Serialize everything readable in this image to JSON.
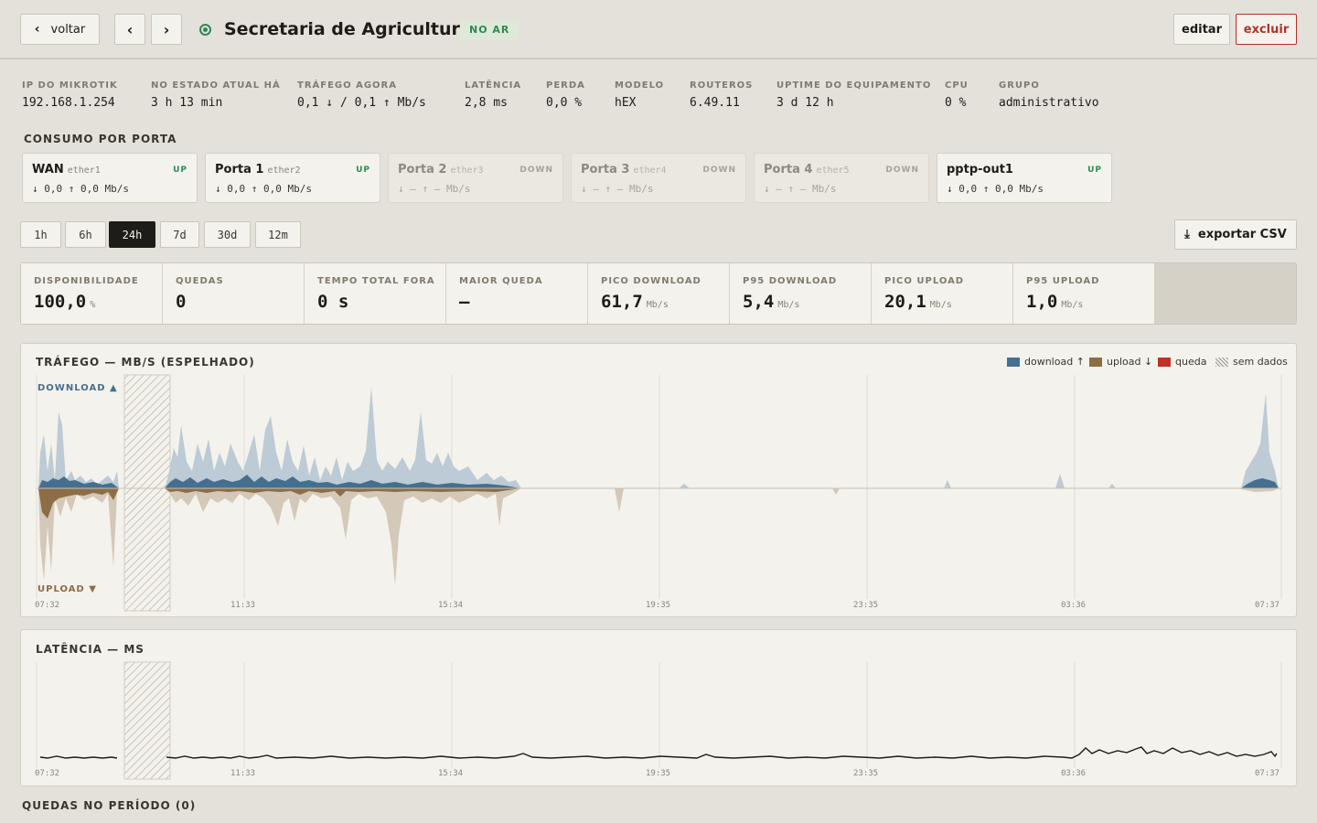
{
  "header": {
    "back_label": "voltar",
    "prev_icon": "chevron-left-icon",
    "next_icon": "chevron-right-icon",
    "title": "Secretaria de Agricultura",
    "status_badge": "NO AR",
    "edit_label": "editar",
    "delete_label": "excluir",
    "status_color": "#2d8a55"
  },
  "stats": [
    {
      "label": "IP DO MIKROTIK",
      "value": "192.168.1.254"
    },
    {
      "label": "NO ESTADO ATUAL HÁ",
      "value": "3 h 13 min"
    },
    {
      "label": "TRÁFEGO AGORA",
      "value": "0,1 ↓ / 0,1 ↑ Mb/s"
    },
    {
      "label": "LATÊNCIA",
      "value": "2,8 ms"
    },
    {
      "label": "PERDA",
      "value": "0,0 %"
    },
    {
      "label": "MODELO",
      "value": "hEX"
    },
    {
      "label": "ROUTEROS",
      "value": "6.49.11"
    },
    {
      "label": "UPTIME DO EQUIPAMENTO",
      "value": "3 d 12 h"
    },
    {
      "label": "CPU",
      "value": "0 %"
    },
    {
      "label": "GRUPO",
      "value": "administrativo"
    }
  ],
  "ports_title": "CONSUMO POR PORTA",
  "ports": [
    {
      "name": "WAN",
      "iface": "ether1",
      "state": "UP",
      "rate": "↓ 0,0 ↑ 0,0 Mb/s"
    },
    {
      "name": "Porta 1",
      "iface": "ether2",
      "state": "UP",
      "rate": "↓ 0,0 ↑ 0,0 Mb/s"
    },
    {
      "name": "Porta 2",
      "iface": "ether3",
      "state": "DOWN",
      "rate": "↓ — ↑ — Mb/s"
    },
    {
      "name": "Porta 3",
      "iface": "ether4",
      "state": "DOWN",
      "rate": "↓ — ↑ — Mb/s"
    },
    {
      "name": "Porta 4",
      "iface": "ether5",
      "state": "DOWN",
      "rate": "↓ — ↑ — Mb/s"
    },
    {
      "name": "pptp-out1",
      "iface": "",
      "state": "UP",
      "rate": "↓ 0,0 ↑ 0,0 Mb/s"
    }
  ],
  "ranges": [
    "1h",
    "6h",
    "24h",
    "7d",
    "30d",
    "12m"
  ],
  "active_range": "24h",
  "export_label": "exportar CSV",
  "kpis": [
    {
      "label": "DISPONIBILIDADE",
      "value": "100,0",
      "unit": "%"
    },
    {
      "label": "QUEDAS",
      "value": "0",
      "unit": ""
    },
    {
      "label": "TEMPO TOTAL FORA",
      "value": "0 s",
      "unit": ""
    },
    {
      "label": "MAIOR QUEDA",
      "value": "—",
      "unit": ""
    },
    {
      "label": "PICO DOWNLOAD",
      "value": "61,7",
      "unit": "Mb/s"
    },
    {
      "label": "P95 DOWNLOAD",
      "value": "5,4",
      "unit": "Mb/s"
    },
    {
      "label": "PICO UPLOAD",
      "value": "20,1",
      "unit": "Mb/s"
    },
    {
      "label": "P95 UPLOAD",
      "value": "1,0",
      "unit": "Mb/s"
    }
  ],
  "traffic_chart": {
    "title": "TRÁFEGO — MB/S (ESPELHADO)",
    "download_label": "DOWNLOAD ▲",
    "upload_label": "UPLOAD ▼",
    "legend": [
      {
        "label": "download ↑",
        "color": "#456f8f"
      },
      {
        "label": "upload ↓",
        "color": "#8c6d45"
      },
      {
        "label": "queda",
        "color": "#c0302b"
      },
      {
        "label": "sem dados",
        "color": "hatch"
      }
    ],
    "x_ticks": [
      "07:32",
      "11:33",
      "15:34",
      "19:35",
      "23:35",
      "03:36",
      "07:37"
    ]
  },
  "latency_chart": {
    "title": "LATÊNCIA — MS",
    "x_ticks": [
      "07:32",
      "11:33",
      "15:34",
      "19:35",
      "23:35",
      "03:36",
      "07:37"
    ]
  },
  "chart_data": [
    {
      "type": "area",
      "title": "TRÁFEGO — MB/S (ESPELHADO)",
      "xlabel": "",
      "ylabel": "",
      "x": [
        "07:32",
        "11:33",
        "15:34",
        "19:35",
        "23:35",
        "03:36",
        "07:37"
      ],
      "grid": true,
      "legend_position": "top-right",
      "no_data_range": [
        "08:24",
        "09:18"
      ],
      "series": [
        {
          "name": "download ↑",
          "peak": 61.7,
          "p95": 5.4
        },
        {
          "name": "upload ↓",
          "peak": 20.1,
          "p95": 1.0
        }
      ]
    },
    {
      "type": "line",
      "title": "LATÊNCIA — MS",
      "x": [
        "07:32",
        "11:33",
        "15:34",
        "19:35",
        "23:35",
        "03:36",
        "07:37"
      ],
      "grid": true,
      "no_data_range": [
        "08:24",
        "09:18"
      ]
    }
  ],
  "drops_title": "QUEDAS NO PERÍODO (0)"
}
